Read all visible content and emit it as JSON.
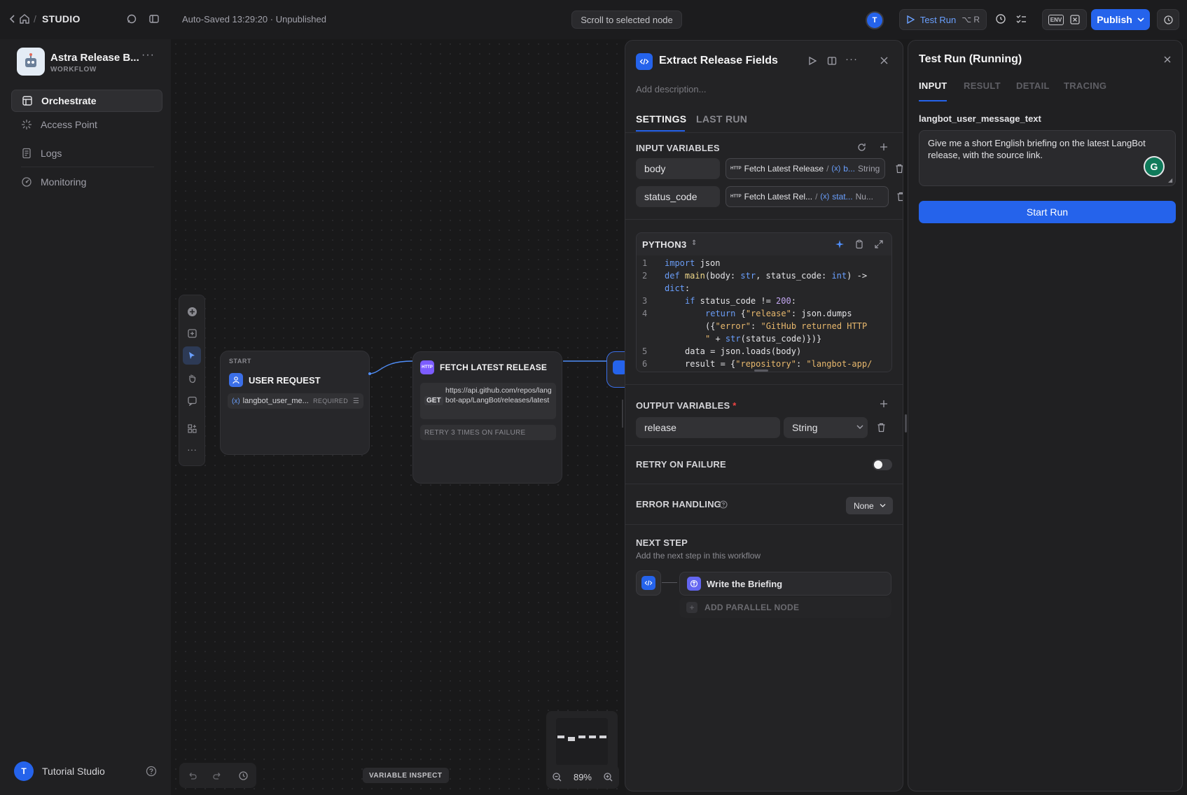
{
  "topbar": {
    "breadcrumb_studio": "STUDIO",
    "autosave": "Auto-Saved 13:29:20 · Unpublished",
    "scroll_button": "Scroll to selected node",
    "avatar_initial": "T",
    "test_run_label": "Test Run",
    "test_run_shortcut": "⌥ R",
    "env_label": "ENV",
    "publish_label": "Publish"
  },
  "app": {
    "name": "Astra Release B...",
    "type": "WORKFLOW"
  },
  "sidebar": {
    "items": [
      {
        "label": "Orchestrate",
        "icon": "orchestrate-icon",
        "active": true
      },
      {
        "label": "Access Point",
        "icon": "access-point-icon",
        "active": false
      },
      {
        "label": "Logs",
        "icon": "logs-icon",
        "active": false
      },
      {
        "label": "Monitoring",
        "icon": "monitoring-icon",
        "active": false
      }
    ],
    "footer_initial": "T",
    "footer_name": "Tutorial Studio"
  },
  "canvas": {
    "start_node": {
      "tag": "START",
      "title": "USER REQUEST",
      "variable": "langbot_user_me...",
      "required": "REQUIRED"
    },
    "http_node": {
      "badge": "HTTP",
      "title": "FETCH LATEST RELEASE",
      "method": "GET",
      "url": "https://api.github.com/repos/langbot-app/LangBot/releases/latest",
      "retry": "RETRY 3 TIMES ON FAILURE"
    },
    "variable_inspect": "VARIABLE INSPECT",
    "zoom": "89%"
  },
  "settings": {
    "title": "Extract Release Fields",
    "description_placeholder": "Add description...",
    "tabs": [
      "SETTINGS",
      "LAST RUN"
    ],
    "input_variables_title": "INPUT VARIABLES",
    "inputs": [
      {
        "name": "body",
        "source_node": "Fetch Latest Release",
        "source_var": "b...",
        "type": "String"
      },
      {
        "name": "status_code",
        "source_node": "Fetch Latest Rel...",
        "source_var": "stat...",
        "type": "Nu..."
      }
    ],
    "var_badge": "(x)",
    "language": "PYTHON3",
    "output_variables_title": "OUTPUT VARIABLES",
    "required_mark": "*",
    "outputs": [
      {
        "name": "release",
        "type": "String"
      }
    ],
    "retry_title": "RETRY ON FAILURE",
    "retry_enabled": false,
    "error_title": "ERROR HANDLING",
    "error_value": "None",
    "next_step_title": "NEXT STEP",
    "next_step_subtitle": "Add the next step in this workflow",
    "next_node": "Write the Briefing",
    "add_parallel": "ADD PARALLEL NODE"
  },
  "testrun": {
    "title": "Test Run (Running)",
    "tabs": [
      "INPUT",
      "RESULT",
      "DETAIL",
      "TRACING"
    ],
    "field_label": "langbot_user_message_text",
    "field_value": "Give me a short English briefing on the latest LangBot release, with the source link.",
    "start_button": "Start Run"
  },
  "colors": {
    "accent": "#2563eb",
    "accent_light": "#4f8df7",
    "http_purple": "#7c5cff"
  }
}
